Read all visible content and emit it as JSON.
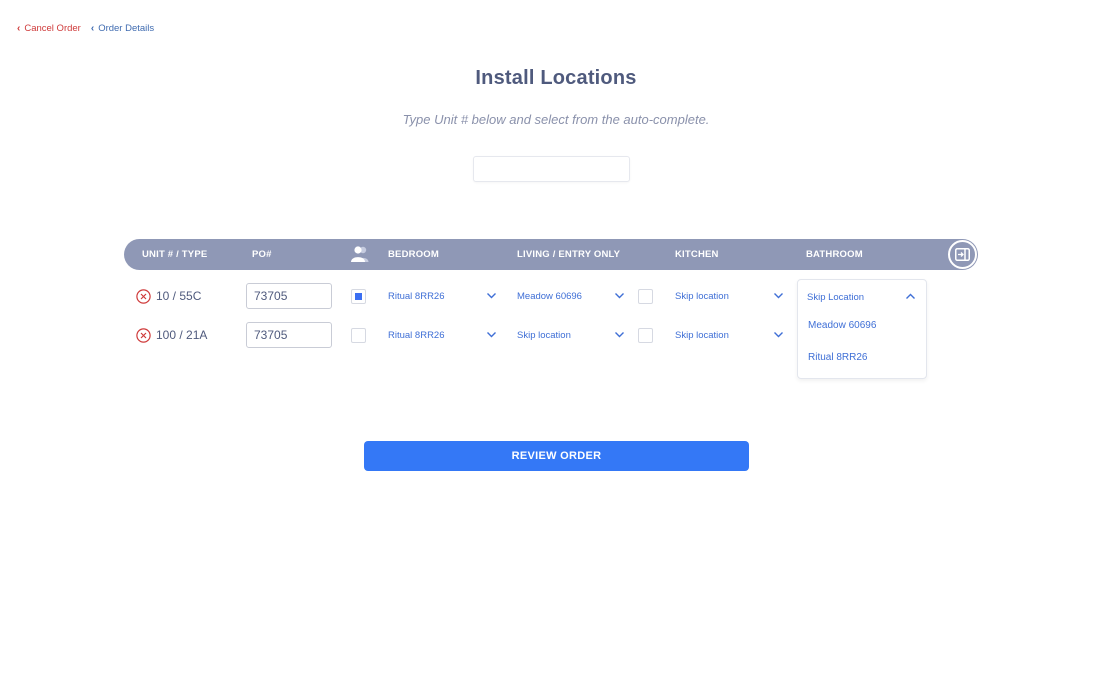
{
  "nav": {
    "cancel_label": "Cancel Order",
    "back_label": "Order Details"
  },
  "page": {
    "title": "Install Locations",
    "subtitle": "Type Unit # below and select from the auto-complete.",
    "search_value": ""
  },
  "table": {
    "headers": {
      "unit": "UNIT # / TYPE",
      "po": "PO#",
      "person_icon": "person-group-icon",
      "bedroom": "BEDROOM",
      "living": "LIVING / ENTRY ONLY",
      "kitchen": "KITCHEN",
      "bathroom": "BATHROOM",
      "collapse_icon": "collapse-panel-icon"
    },
    "rows": [
      {
        "unit": "10 / 55C",
        "po": "73705",
        "bedroom_checked": true,
        "bedroom": "Ritual 8RR26",
        "living_checked": false,
        "living": "Meadow 60696",
        "kitchen": "Skip location",
        "bathroom": "Skip Location"
      },
      {
        "unit": "100 / 21A",
        "po": "73705",
        "bedroom_checked": false,
        "bedroom": "Ritual 8RR26",
        "living_checked": false,
        "living": "Skip location",
        "kitchen": "Skip location",
        "bathroom": ""
      }
    ]
  },
  "dropdown": {
    "selected": "Skip Location",
    "options": [
      "Meadow 60696",
      "Ritual 8RR26"
    ]
  },
  "actions": {
    "review_label": "REVIEW ORDER"
  },
  "colors": {
    "header_bg": "#8f98b6",
    "accent_blue": "#3478f6",
    "cancel_red": "#cf3b3b",
    "link_blue": "#3f6fd6"
  }
}
